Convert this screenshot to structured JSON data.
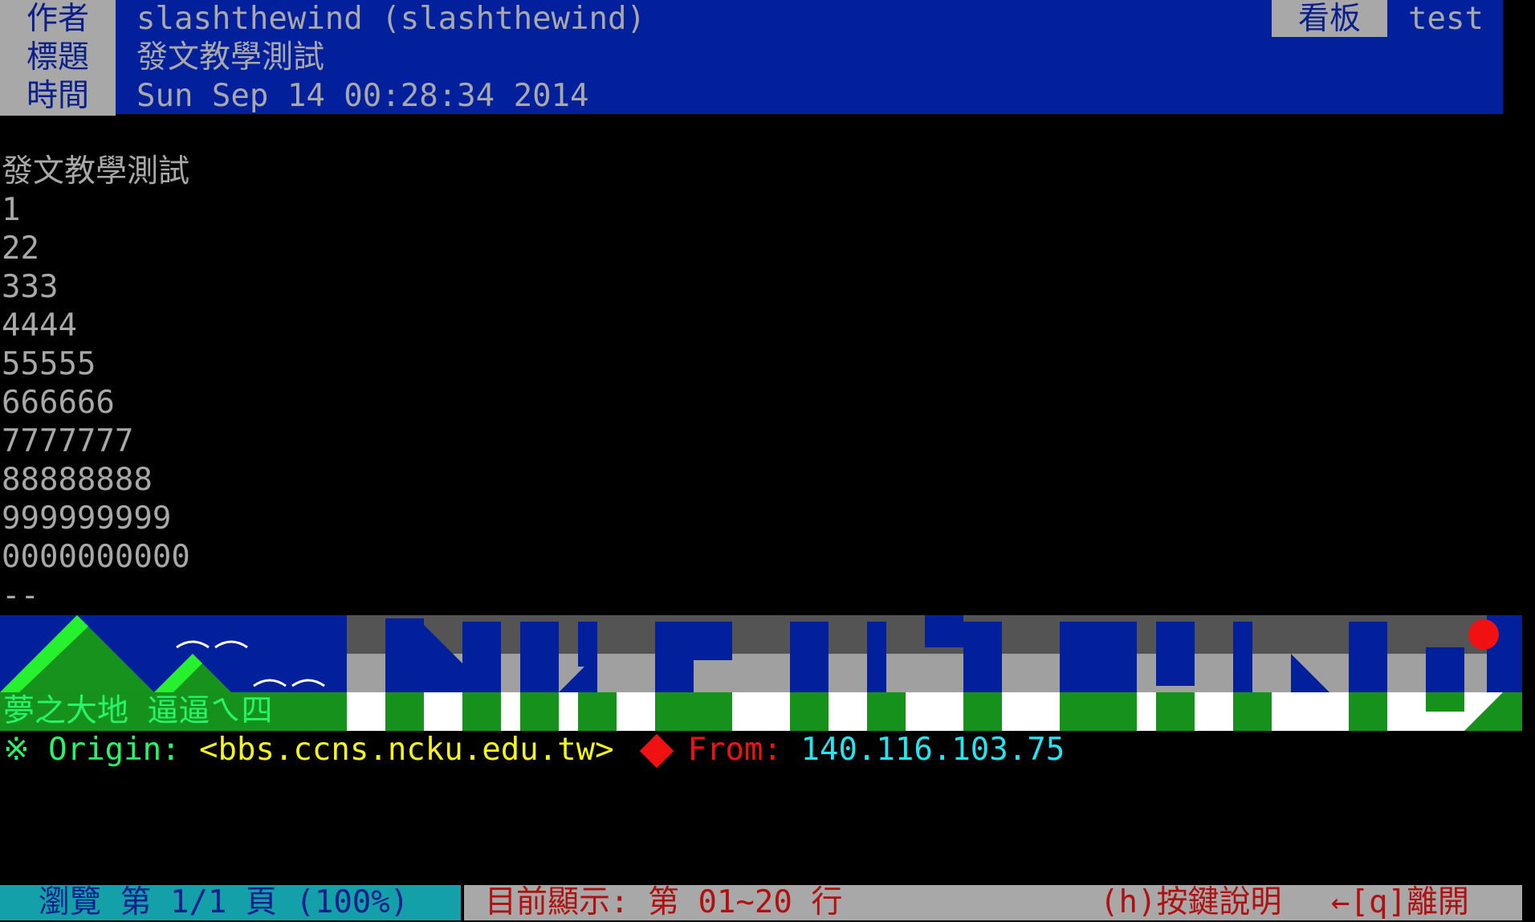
{
  "header": {
    "author_label": "作者",
    "author_value": "slashthewind (slashthewind)",
    "title_label": "標題",
    "title_value": "發文教學測試",
    "time_label": "時間",
    "time_value": "Sun Sep 14 00:28:34 2014",
    "board_label": "看板",
    "board_name": "test"
  },
  "body": {
    "lines": [
      "發文教學測試",
      "1",
      "22",
      "333",
      "4444",
      "55555",
      "666666",
      "7777777",
      "88888888",
      "999999999",
      "0000000000",
      "--"
    ]
  },
  "banner": {
    "text": "夢之大地 逼逼ㄟ四"
  },
  "signature": {
    "mark": "※",
    "origin_label": "Origin:",
    "origin_value": "<bbs.ccns.ncku.edu.tw>",
    "from_label": "From:",
    "from_value": "140.116.103.75"
  },
  "footer": {
    "browse": "瀏覽 第 1/1 頁 (100%)",
    "display": "目前顯示: 第 01~20 行",
    "help": "(h)按鍵說明",
    "leave": "←[q]離開"
  },
  "colors": {
    "header_bg": "#02209b",
    "label_bg": "#a8a8a8",
    "footer_left_bg": "#14a0a8",
    "footer_right_text": "#b01010"
  }
}
